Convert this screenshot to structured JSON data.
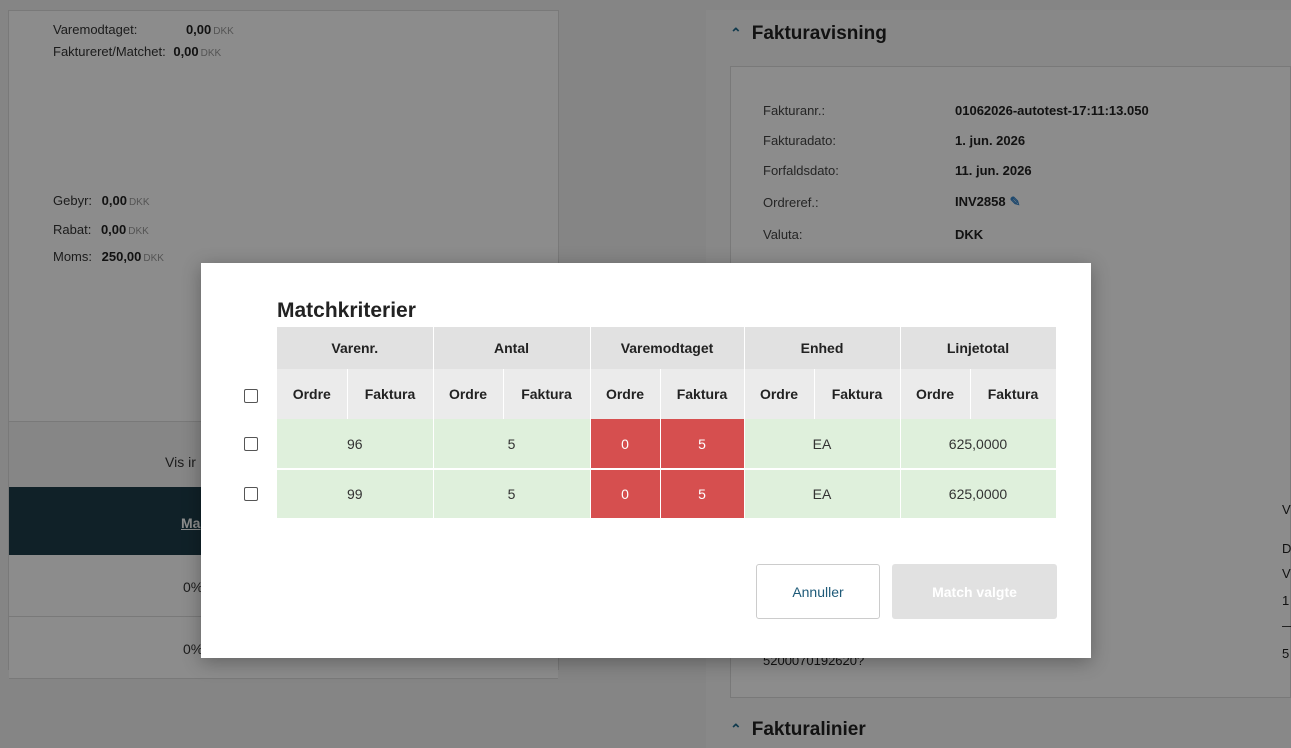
{
  "left_summary": {
    "varemodtaget_label": "Varemodtaget:",
    "varemodtaget_value": "0,00",
    "faktureret_label": "Faktureret/Matchet:",
    "faktureret_value": "0,00",
    "gebyr_label": "Gebyr:",
    "gebyr_value": "0,00",
    "rabat_label": "Rabat:",
    "rabat_value": "0,00",
    "moms_label": "Moms:",
    "moms_value": "250,00",
    "currency": "DKK",
    "vis_label": "Vis ir",
    "dark_label": "Ma",
    "pct1": "0%",
    "pct2": "0%"
  },
  "invoice": {
    "section_title": "Fakturavisning",
    "fakturanr_label": "Fakturanr.:",
    "fakturanr_value": "01062026-autotest-17:11:13.050",
    "fakturadato_label": "Fakturadato:",
    "fakturadato_value": "1. jun. 2026",
    "forfaldsdato_label": "Forfaldsdato:",
    "forfaldsdato_value": "11. jun. 2026",
    "ordreref_label": "Ordreref.:",
    "ordreref_value": "INV2858",
    "valuta_label": "Valuta:",
    "valuta_value": "DKK",
    "partial_bottom": "5200070192620?",
    "lines_title": "Fakturalinier",
    "edge_v1": "V",
    "edge_d": "D",
    "edge_v2": "V",
    "edge_1": "1",
    "edge_dash": "—",
    "edge_5": "5"
  },
  "modal": {
    "title": "Matchkriterier",
    "groups": [
      "Varenr.",
      "Antal",
      "Varemodtaget",
      "Enhed",
      "Linjetotal"
    ],
    "sub_ordre": "Ordre",
    "sub_faktura": "Faktura",
    "rows": [
      {
        "varenr": "96",
        "antal": "5",
        "vm_ordre": "0",
        "vm_faktura": "5",
        "enhed": "EA",
        "linjetotal": "625,0000"
      },
      {
        "varenr": "99",
        "antal": "5",
        "vm_ordre": "0",
        "vm_faktura": "5",
        "enhed": "EA",
        "linjetotal": "625,0000"
      }
    ],
    "cancel_label": "Annuller",
    "match_label": "Match valgte"
  },
  "colors": {
    "match_ok": "#dff0dc",
    "mismatch": "#d64f4f",
    "accent": "#1e3c4a"
  }
}
